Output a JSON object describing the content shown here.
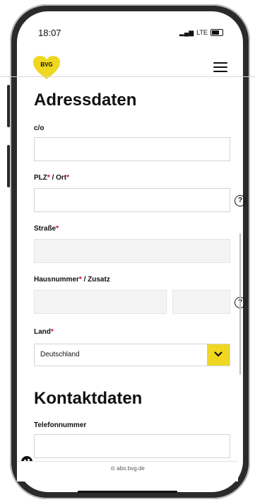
{
  "status": {
    "time": "18:07",
    "network": "LTE"
  },
  "header": {
    "logo_text": "BVG",
    "brand_color": "#f0d722"
  },
  "address": {
    "title": "Adressdaten",
    "co_label": "c/o",
    "plz_label": "PLZ",
    "req": "*",
    "ort_label": " / Ort",
    "strasse_label": "Straße",
    "hausnummer_label": "Hausnummer",
    "zusatz_label": " / Zusatz",
    "land_label": "Land",
    "land_value": "Deutschland",
    "help_symbol": "?"
  },
  "contact": {
    "title": "Kontaktdaten",
    "phone_label": "Telefonnummer"
  },
  "browser": {
    "url": "abo.bvg.de"
  }
}
